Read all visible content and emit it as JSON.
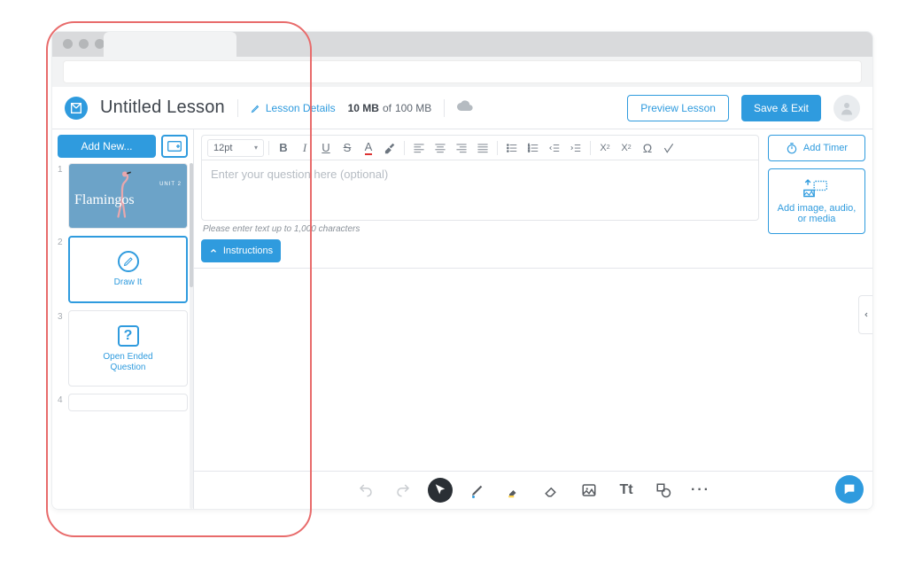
{
  "header": {
    "title": "Untitled Lesson",
    "lesson_details": "Lesson Details",
    "storage_used": "10 MB",
    "storage_of": "of",
    "storage_total": "100 MB",
    "preview": "Preview Lesson",
    "save": "Save & Exit"
  },
  "sidebar": {
    "add_new": "Add New...",
    "slides": [
      {
        "num": "1",
        "type": "flamingo",
        "title_text": "Flamingos",
        "unit_text": "UNIT 2"
      },
      {
        "num": "2",
        "type": "drawit",
        "label": "Draw It"
      },
      {
        "num": "3",
        "type": "oeq",
        "label": "Open Ended\nQuestion"
      },
      {
        "num": "4",
        "type": "blank",
        "label": ""
      }
    ]
  },
  "editor": {
    "font_size": "12pt",
    "placeholder": "Enter your question here (optional)",
    "hint": "Please enter text up to 1,000 characters"
  },
  "side_panel": {
    "timer": "Add Timer",
    "media": "Add image, audio, or media"
  },
  "instructions_btn": "Instructions",
  "colors": {
    "accent": "#2f9bde",
    "annotation": "#e86b6b"
  }
}
